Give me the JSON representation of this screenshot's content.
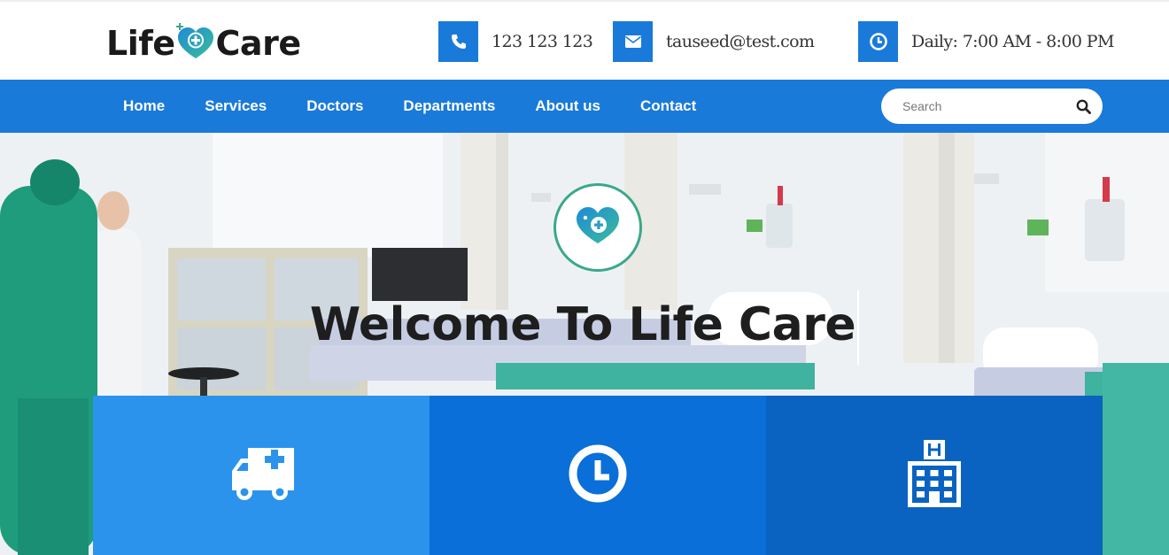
{
  "brand": {
    "logo_left": "Life",
    "logo_right": "Care"
  },
  "contacts": {
    "phone": {
      "icon": "phone-icon",
      "text": "123 123 123"
    },
    "email": {
      "icon": "envelope-icon",
      "text": "tauseed@test.com"
    },
    "hours": {
      "icon": "clock-icon",
      "text": "Daily: 7:00 AM - 8:00 PM"
    }
  },
  "nav": {
    "items": [
      {
        "label": "Home"
      },
      {
        "label": "Services"
      },
      {
        "label": "Doctors"
      },
      {
        "label": "Departments"
      },
      {
        "label": "About us"
      },
      {
        "label": "Contact"
      }
    ],
    "search": {
      "placeholder": "Search",
      "icon": "search-icon"
    }
  },
  "hero": {
    "emblem_icon": "heart-plus-icon",
    "title": "Welcome To Life Care"
  },
  "features": [
    {
      "icon": "ambulance-icon"
    },
    {
      "icon": "clock-icon"
    },
    {
      "icon": "hospital-icon"
    }
  ],
  "colors": {
    "primary": "#1a7ad9",
    "feature_1": "#2b93ec",
    "feature_2": "#0a6fd8",
    "feature_3": "#0a63c0",
    "brand_teal": "#3aa88a"
  }
}
